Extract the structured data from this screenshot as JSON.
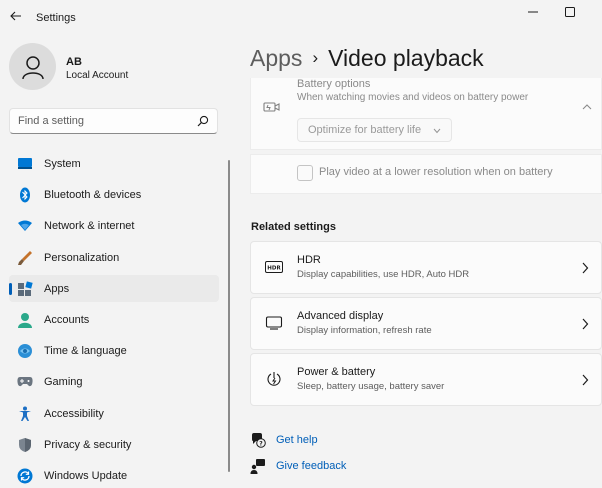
{
  "window": {
    "title": "Settings"
  },
  "account": {
    "initials": "AB",
    "type": "Local Account"
  },
  "search": {
    "placeholder": "Find a setting",
    "value": ""
  },
  "sidebar": {
    "items": [
      {
        "label": "System",
        "icon": "system-icon"
      },
      {
        "label": "Bluetooth & devices",
        "icon": "bluetooth-icon"
      },
      {
        "label": "Network & internet",
        "icon": "network-icon"
      },
      {
        "label": "Personalization",
        "icon": "personalization-icon"
      },
      {
        "label": "Apps",
        "icon": "apps-icon",
        "selected": true
      },
      {
        "label": "Accounts",
        "icon": "accounts-icon"
      },
      {
        "label": "Time & language",
        "icon": "time-language-icon"
      },
      {
        "label": "Gaming",
        "icon": "gaming-icon"
      },
      {
        "label": "Accessibility",
        "icon": "accessibility-icon"
      },
      {
        "label": "Privacy & security",
        "icon": "privacy-icon"
      },
      {
        "label": "Windows Update",
        "icon": "windows-update-icon"
      }
    ]
  },
  "header": {
    "parent": "Apps",
    "separator": "›",
    "current": "Video playback"
  },
  "battery": {
    "title": "Battery options",
    "subtitle": "When watching movies and videos on battery power",
    "select_value": "Optimize for battery life",
    "lowres_label": "Play video at a lower resolution when on battery",
    "lowres_checked": false
  },
  "related": {
    "heading": "Related settings",
    "items": [
      {
        "title": "HDR",
        "subtitle": "Display capabilities, use HDR, Auto HDR",
        "icon": "hdr-icon"
      },
      {
        "title": "Advanced display",
        "subtitle": "Display information, refresh rate",
        "icon": "monitor-icon"
      },
      {
        "title": "Power & battery",
        "subtitle": "Sleep, battery usage, battery saver",
        "icon": "power-icon"
      }
    ]
  },
  "help": {
    "get_help": "Get help",
    "give_feedback": "Give feedback"
  },
  "colors": {
    "accent": "#005fb8",
    "background": "#f3f3f3",
    "card": "#fbfbfb"
  }
}
